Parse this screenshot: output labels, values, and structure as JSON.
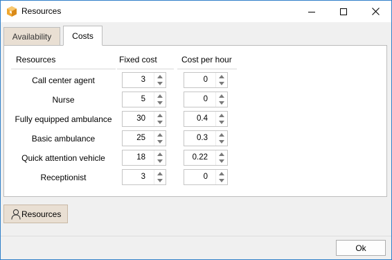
{
  "window": {
    "title": "Resources",
    "icon": "orange-cube-icon",
    "controls": [
      "minimize-icon",
      "maximize-icon",
      "close-icon"
    ]
  },
  "tabs": [
    {
      "label": "Availability",
      "active": false
    },
    {
      "label": "Costs",
      "active": true
    }
  ],
  "table": {
    "headers": {
      "resources": "Resources",
      "fixed_cost": "Fixed cost",
      "cost_per_hour": "Cost per hour"
    },
    "rows": [
      {
        "resource": "Call center agent",
        "fixed_cost": "3",
        "cost_per_hour": "0"
      },
      {
        "resource": "Nurse",
        "fixed_cost": "5",
        "cost_per_hour": "0"
      },
      {
        "resource": "Fully equipped ambulance",
        "fixed_cost": "30",
        "cost_per_hour": "0.4"
      },
      {
        "resource": "Basic ambulance",
        "fixed_cost": "25",
        "cost_per_hour": "0.3"
      },
      {
        "resource": "Quick attention vehicle",
        "fixed_cost": "18",
        "cost_per_hour": "0.22"
      },
      {
        "resource": "Receptionist",
        "fixed_cost": "3",
        "cost_per_hour": "0"
      }
    ]
  },
  "resources_button": {
    "label": "Resources",
    "icon": "person-icon"
  },
  "footer": {
    "ok_label": "Ok"
  },
  "colors": {
    "window_border": "#2f7fc9",
    "tab_inactive": "#e9dfd3",
    "app_icon": "#f0a830"
  }
}
